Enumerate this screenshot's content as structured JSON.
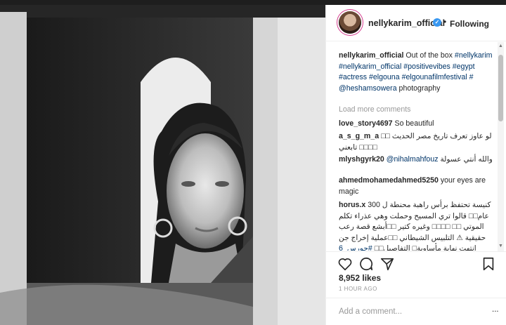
{
  "post": {
    "username": "nellykarim_official",
    "follow_status": "Following",
    "separator": "•",
    "caption_text": "Out of the box",
    "caption_tags": [
      "#nellykarim",
      "#nellykarim_official",
      "#positivevibes",
      "#egypt",
      "#actress",
      "#elgouna",
      "#elgounafilmfestival",
      "#",
      "@heshamsowera"
    ],
    "caption_tail": "photography",
    "load_more": "Load more comments",
    "likes": "8,952 likes",
    "time": "1 HOUR AGO",
    "add_comment_placeholder": "Add a comment...",
    "more": "..."
  },
  "comments": [
    {
      "user": "love_story4697",
      "text": "So beautiful"
    },
    {
      "user": "a_s_g_m_a",
      "text": "لو عاوز تعرف تاريخ مصر الحديث □□ تابعني □□□□"
    },
    {
      "user": "mlyshgyrk20",
      "mention": "@nihalmahfouz",
      "text": "والله أنتي عسولة"
    },
    {
      "user": "ahmedmohamedahmed5250",
      "text": "your eyes are magic"
    },
    {
      "user": "horus.x",
      "text": "كنيسة تحتفظ برأس راهبة محنطة ل 300 عام□□ قالوا تري المسيح وحملت وهي عذراء تكلم الموتي □□ □□□□ وغيره كتير □□أبشع قصة رعب حقيقية ⚠ التلبيس الشيطاني □□عملية إخراج جن انتهت نهاية مأساوية□ التفاصيل□□",
      "tag": "#حورس_6"
    }
  ],
  "icons": [
    "heart-icon",
    "comment-icon",
    "share-icon",
    "bookmark-icon",
    "verified-icon",
    "scroll-up-arrow",
    "scroll-down-arrow"
  ]
}
